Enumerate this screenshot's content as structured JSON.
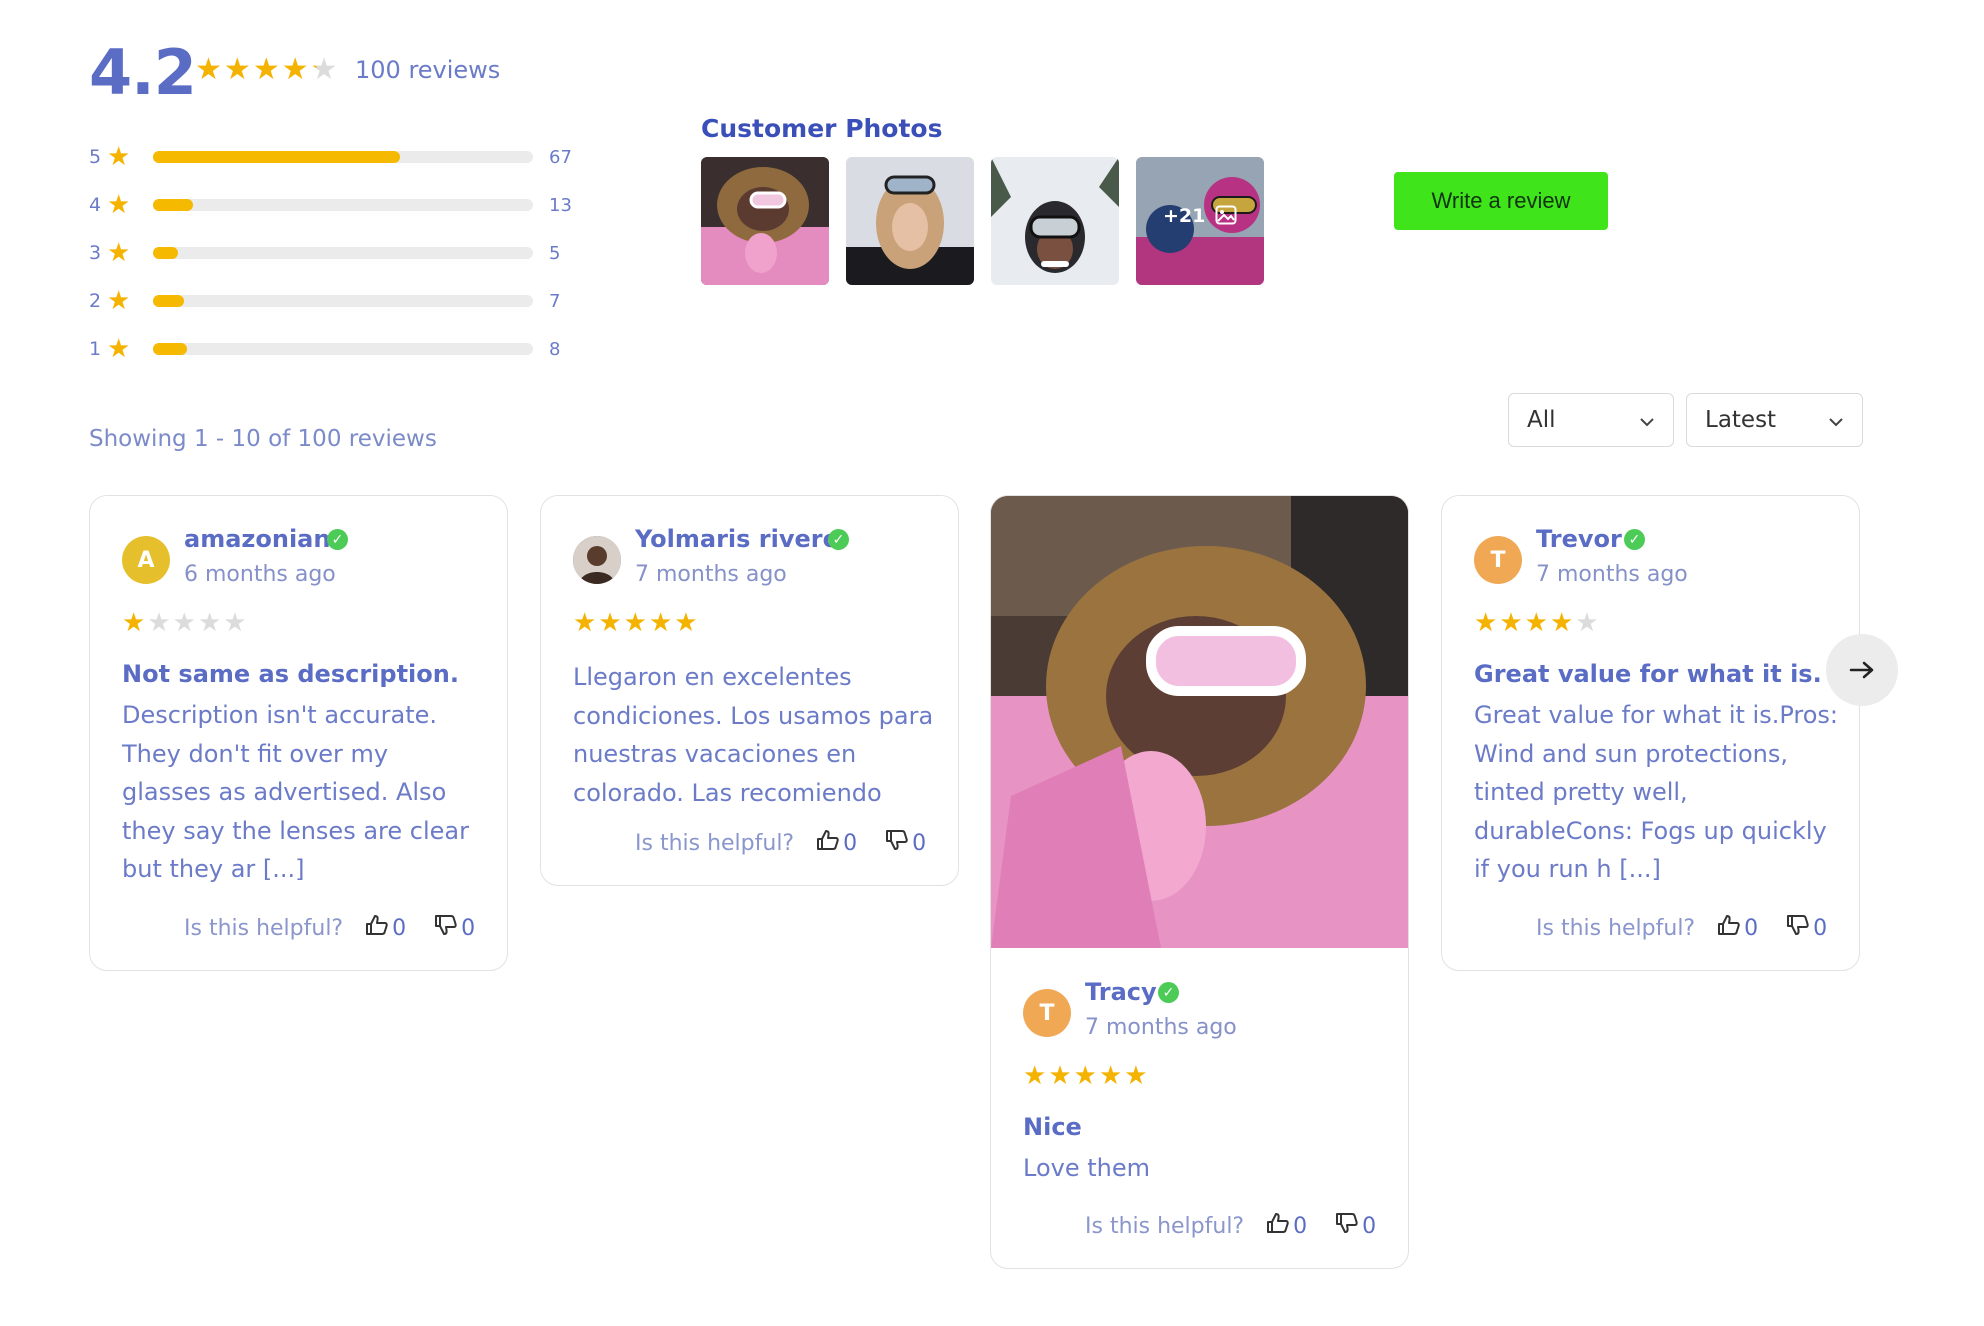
{
  "summary": {
    "rating": "4.2",
    "stars": 4.2,
    "review_count": "100 reviews",
    "distribution": [
      {
        "stars": "5",
        "count": "67",
        "fraction": 0.67
      },
      {
        "stars": "4",
        "count": "13",
        "fraction": 0.13
      },
      {
        "stars": "3",
        "count": "5",
        "fraction": 0.05
      },
      {
        "stars": "2",
        "count": "7",
        "fraction": 0.07
      },
      {
        "stars": "1",
        "count": "8",
        "fraction": 0.08
      }
    ]
  },
  "photos": {
    "title": "Customer Photos",
    "more_label": "+21"
  },
  "write_review": "Write a review",
  "showing": "Showing 1 - 10 of 100 reviews",
  "filters": {
    "rating_filter": "All",
    "sort": "Latest"
  },
  "helpful_label": "Is this helpful?",
  "reviews": [
    {
      "author": "amazonian",
      "initial": "A",
      "date": "6 months ago",
      "stars": 1,
      "title": "Not same as description.",
      "body": "Description isn't accurate. They don't fit over my glasses as advertised. Also they say the lenses are clear but they ar [...]",
      "up": "0",
      "down": "0"
    },
    {
      "author": "Yolmaris rivero",
      "date": "7 months ago",
      "stars": 5,
      "title": "",
      "body": "Llegaron en excelentes condiciones. Los usamos para nuestras vacaciones en colorado. Las recomiendo",
      "up": "0",
      "down": "0"
    },
    {
      "author": "Tracy",
      "initial": "T",
      "date": "7 months ago",
      "stars": 5,
      "title": "Nice",
      "body": "Love them",
      "up": "0",
      "down": "0"
    },
    {
      "author": "Trevor",
      "initial": "T",
      "date": "7 months ago",
      "stars": 4,
      "title": "Great value for what it is.",
      "body": "Great value for what it is.Pros: Wind and sun protections, tinted pretty well, durableCons: Fogs up quickly if you run h [...]",
      "up": "0",
      "down": "0"
    }
  ],
  "colors": {
    "accent": "#5a6cc4",
    "star": "#f5b301",
    "bar": "#f5b900",
    "button": "#3fe41a",
    "verified": "#4ccc57"
  }
}
